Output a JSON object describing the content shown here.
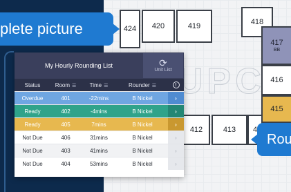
{
  "callouts": {
    "left_text": "plete picture",
    "right_text": "Rou"
  },
  "floor": {
    "rooms": [
      "424",
      "420",
      "419",
      "418",
      "417",
      "416",
      "415",
      "412",
      "413",
      "4"
    ],
    "room_417_sub": "BB"
  },
  "panel": {
    "title": "My Hourly Rounding List",
    "unit_list_label": "Unit List",
    "columns": {
      "status": "Status",
      "room": "Room",
      "time": "Time",
      "rounder": "Rounder"
    },
    "rows": [
      {
        "status": "Overdue",
        "room": "401",
        "time": "-22mins",
        "rounder": "B Nickel"
      },
      {
        "status": "Ready",
        "room": "402",
        "time": "-4mins",
        "rounder": "B Nickel"
      },
      {
        "status": "Ready",
        "room": "405",
        "time": "7mins",
        "rounder": "B Nickel"
      },
      {
        "status": "Not Due",
        "room": "406",
        "time": "31mins",
        "rounder": "B Nickel"
      },
      {
        "status": "Not Due",
        "room": "403",
        "time": "41mins",
        "rounder": "B Nickel"
      },
      {
        "status": "Not Due",
        "room": "404",
        "time": "53mins",
        "rounder": "B Nickel"
      }
    ]
  },
  "colors": {
    "overdue": "#6fa6e2",
    "ready": "#2fa38a",
    "ready_soon": "#e7b84f",
    "callout": "#1f7ad1",
    "header": "#3a3f5c"
  }
}
